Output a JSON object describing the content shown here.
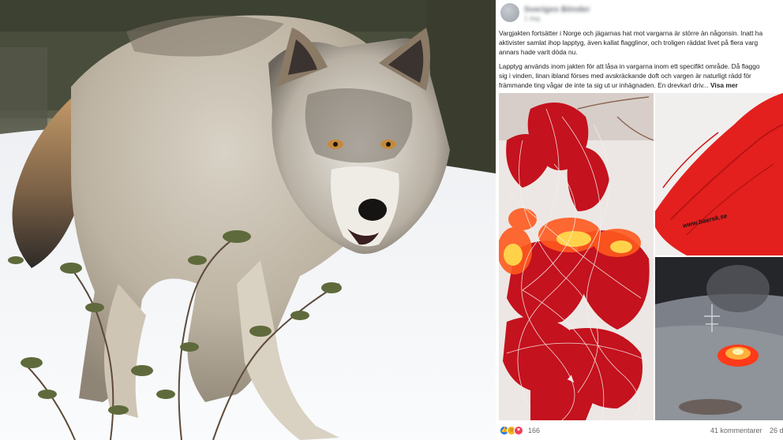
{
  "post": {
    "author_name": "Sveriges Bönder",
    "time": "1 dag",
    "paragraphs": [
      "Vargjakten fortsätter i Norge och jägarnas hat mot vargarna är större än någonsin. Inatt ha",
      "aktivister samlat ihop lapptyg, även kallat flagglinor, och troligen räddat livet på flera varg",
      "annars hade varit döda nu."
    ],
    "paragraphs2": [
      "Lapptyg används inom jakten för att låsa in vargarna inom ett specifikt område. Då flaggo",
      "sig i vinden, linan ibland förses med avskräckande doft och vargen är naturligt rädd för",
      "främmande ting vågar de inte ta sig ut ur inhägnaden. En drevkarl driv..."
    ],
    "see_more": "Visa mer",
    "watermark": "www.baersk.se",
    "reactions": {
      "count": "166",
      "icons": [
        "like-icon",
        "haha-icon",
        "love-icon"
      ],
      "colors": {
        "like": "#1877f2",
        "haha": "#f7b125",
        "love": "#f33e58"
      }
    },
    "comments": "41 kommentarer",
    "shares": "26 d"
  }
}
